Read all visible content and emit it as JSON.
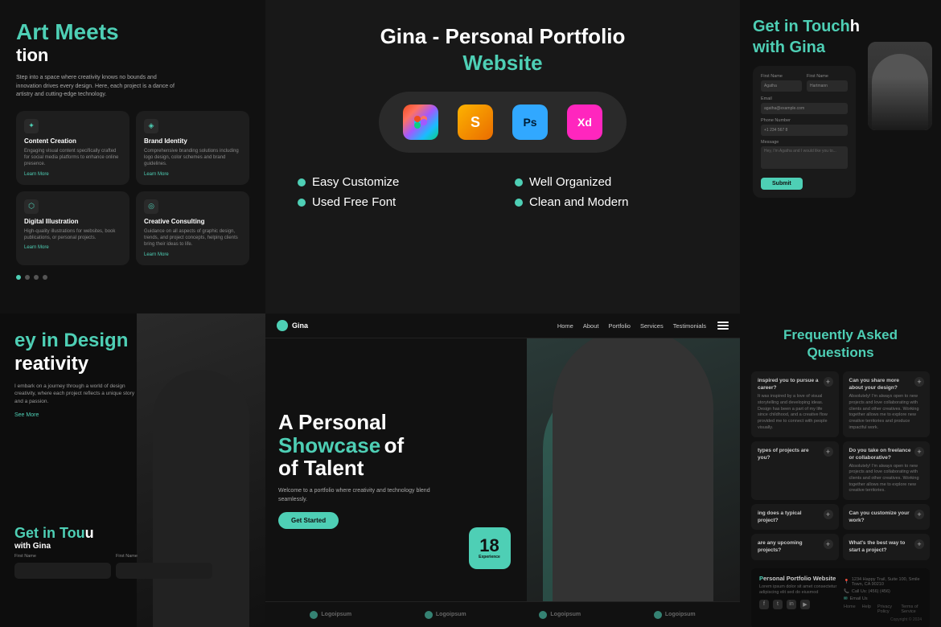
{
  "page": {
    "title": "Gina - Personal Portfolio Website"
  },
  "top_center": {
    "title": "Gina - Personal Portfolio",
    "subtitle": "Website",
    "tools": [
      {
        "name": "Figma",
        "abbr": "F"
      },
      {
        "name": "Sketch",
        "abbr": "S"
      },
      {
        "name": "Photoshop",
        "abbr": "Ps"
      },
      {
        "name": "Adobe XD",
        "abbr": "Xd"
      }
    ],
    "features": [
      {
        "label": "Easy Customize"
      },
      {
        "label": "Well Organized"
      },
      {
        "label": "Used Free Font"
      },
      {
        "label": "Clean and Modern"
      }
    ]
  },
  "top_left": {
    "line1_plain": "Art ",
    "line1_accent": "Meets",
    "line2": "tion",
    "subtitle": "Step into a space where creativity knows no bounds and innovation drives every design. Here, each project is a dance of artistry and cutting-edge technology.",
    "services": [
      {
        "icon": "✦",
        "title": "Content Creation",
        "desc": "Engaging visual content specifically crafted for social media platforms to enhance online presence.",
        "link": "Learn More"
      },
      {
        "icon": "◈",
        "title": "Brand Identity",
        "desc": "Comprehensive branding solutions including logo design, color schemes and brand guidelines.",
        "link": "Learn More"
      },
      {
        "icon": "⬡",
        "title": "Digital Illustration",
        "desc": "High-quality illustrations for websites, book publications, or personal projects.",
        "link": "Learn More"
      },
      {
        "icon": "◎",
        "title": "Creative Consulting",
        "desc": "Guidance on all aspects of graphic design, trends, and project concepts, helping clients bring their ideas to life.",
        "link": "Learn More"
      }
    ],
    "dots": [
      true,
      false,
      false,
      false
    ]
  },
  "top_right": {
    "title_plain": "Get in ",
    "title_accent": "Touch",
    "title_line2": "with Gina",
    "form": {
      "first_name_label": "First Name",
      "last_name_label": "First Name",
      "email_label": "Email",
      "phone_label": "Phone Number",
      "phone_placeholder": "+1 234 567 8",
      "message_label": "Message",
      "message_placeholder": "Hey, I'm Agatha and I would like you to...",
      "submit": "Submit"
    }
  },
  "bottom_left": {
    "key_line1_plain": "ey in ",
    "key_line1_accent": "Design",
    "key_line2": "reativity",
    "subtitle": "I embark on a journey through a world of design creativity, where each project reflects a unique story and a passion.",
    "see_more": "See More",
    "contact_title_plain": "Get in ",
    "contact_title_accent": "Tou",
    "contact_subtitle": "with Gina",
    "form_field_label": "First Name"
  },
  "bottom_center": {
    "nav": {
      "brand": "Gina",
      "links": [
        "Home",
        "About",
        "Portfolio",
        "Services",
        "Testimonials"
      ]
    },
    "hero": {
      "title_plain1": "A Personal",
      "title_accent": "Showcase",
      "title_plain2": "of Talent",
      "desc": "Welcome to a portfolio where creativity and technology blend seamlessly.",
      "cta": "Get Started",
      "exp_number": "18",
      "exp_label": "Experience"
    },
    "logos": [
      {
        "name": "Logoipsum"
      },
      {
        "name": "Logoipsum"
      },
      {
        "name": "Logoipsum"
      },
      {
        "name": "Logoipsum"
      }
    ]
  },
  "bottom_right": {
    "faq_title_plain": "Frequently ",
    "faq_title_accent": "Asked",
    "faq_title_line2": "Questions",
    "faqs": [
      {
        "question": "inspired you to pursue a career?",
        "answer": "It was inspired by a love of visual storytelling and developing ideas. Design has been a part of my life since childhood, and a creative flow provided me to connect with people visually."
      },
      {
        "question": "Can you share more about your design?",
        "answer": "Absolutely! I'm always open to new projects and love collaborating with clients and other creatives. Working together allows me to explore new creative territories and produce impactful work."
      },
      {
        "question": "types of projects are you?",
        "answer": ""
      },
      {
        "question": "Do you take on freelance or collaborative?",
        "answer": "Absolutely! I'm always open to new projects and love collaborating with clients and other creatives. Working together allows me to explore new creative territories."
      },
      {
        "question": "ing does a typical project?",
        "answer": ""
      },
      {
        "question": "Can you customize your work?",
        "answer": ""
      },
      {
        "question": "are any upcoming projects?",
        "answer": ""
      },
      {
        "question": "What's the best way to start a project?",
        "answer": ""
      }
    ],
    "footer": {
      "brand": "ersonal Portfolio Website",
      "desc": "Lorem ipsum dolor sit amet consectetur adipiscing elit sed do eiusmod",
      "location": "1234 Happy Trail, Suite 100, Smile Town, CA 90210",
      "phone": "Call Us: (456) (456)",
      "email": "Email Us",
      "nav_links": [
        "Home",
        "Help",
        "Privacy Policy",
        "Terms of Service"
      ],
      "social": [
        "f",
        "t",
        "in",
        "yt"
      ],
      "copyright": "Copyright © 2024"
    }
  }
}
